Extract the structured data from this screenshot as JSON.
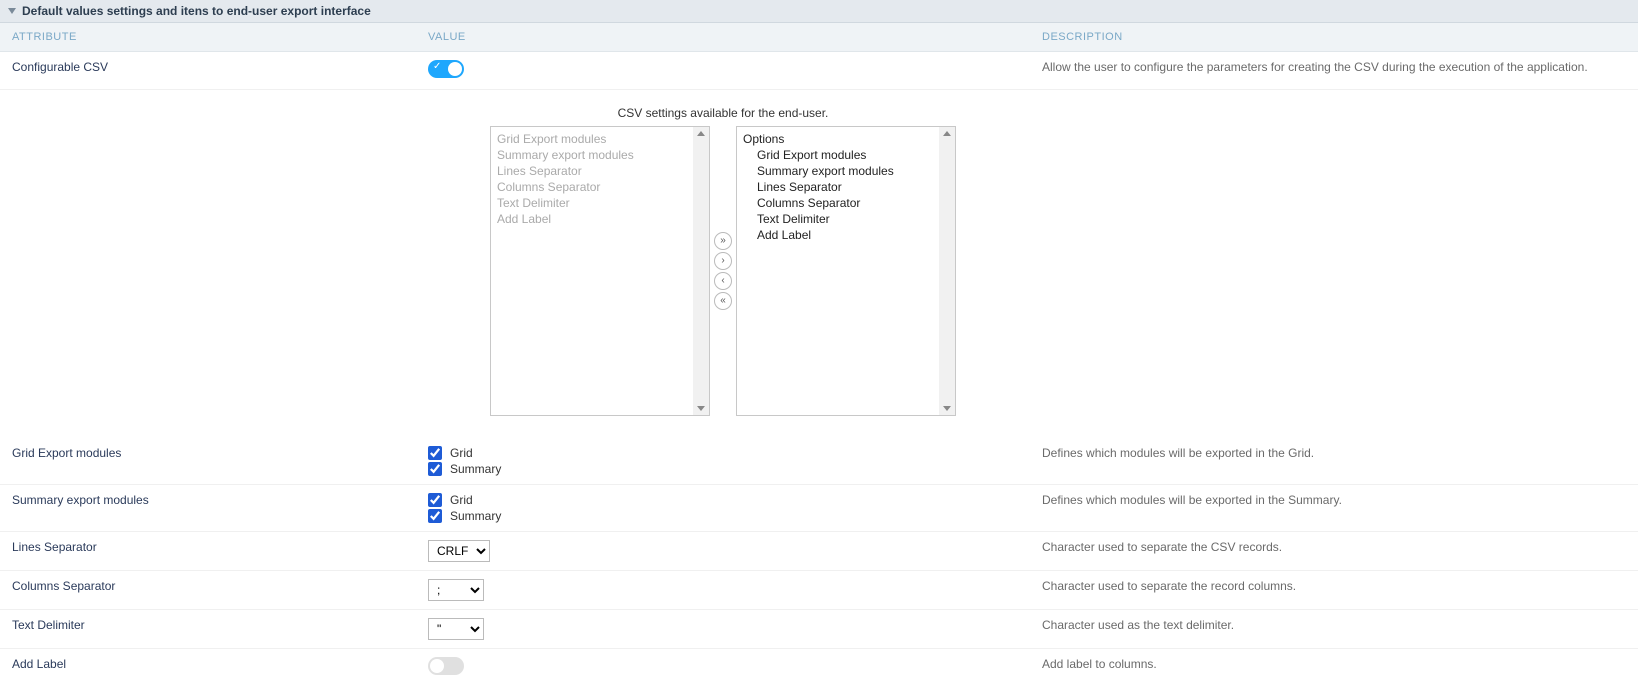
{
  "panel": {
    "title": "Default values settings and itens to end-user export interface"
  },
  "columns": {
    "attr": "Attribute",
    "value": "Value",
    "desc": "Description"
  },
  "rows": {
    "conf_csv": {
      "label": "Configurable CSV",
      "desc": "Allow the user to configure the parameters for creating the CSV during the execution of the application.",
      "value": true
    },
    "dual_list": {
      "title": "CSV settings available for the end-user.",
      "left": [
        "Grid Export modules",
        "Summary export modules",
        "Lines Separator",
        "Columns Separator",
        "Text Delimiter",
        "Add Label"
      ],
      "right_group": "Options",
      "right": [
        "Grid Export modules",
        "Summary export modules",
        "Lines Separator",
        "Columns Separator",
        "Text Delimiter",
        "Add Label"
      ],
      "buttons": {
        "all_right": "»",
        "right": "›",
        "left": "‹",
        "all_left": "«"
      }
    },
    "grid_export": {
      "label": "Grid Export modules",
      "desc": "Defines which modules will be exported in the Grid.",
      "opts": [
        {
          "label": "Grid",
          "checked": true
        },
        {
          "label": "Summary",
          "checked": true
        }
      ]
    },
    "summary_export": {
      "label": "Summary export modules",
      "desc": "Defines which modules will be exported in the Summary.",
      "opts": [
        {
          "label": "Grid",
          "checked": true
        },
        {
          "label": "Summary",
          "checked": true
        }
      ]
    },
    "lines_sep": {
      "label": "Lines Separator",
      "desc": "Character used to separate the CSV records.",
      "value": "CRLF"
    },
    "cols_sep": {
      "label": "Columns Separator",
      "desc": "Character used to separate the record columns.",
      "value": ";"
    },
    "text_delim": {
      "label": "Text Delimiter",
      "desc": "Character used as the text delimiter.",
      "value": "\""
    },
    "add_label": {
      "label": "Add Label",
      "desc": "Add label to columns.",
      "value": false
    }
  }
}
